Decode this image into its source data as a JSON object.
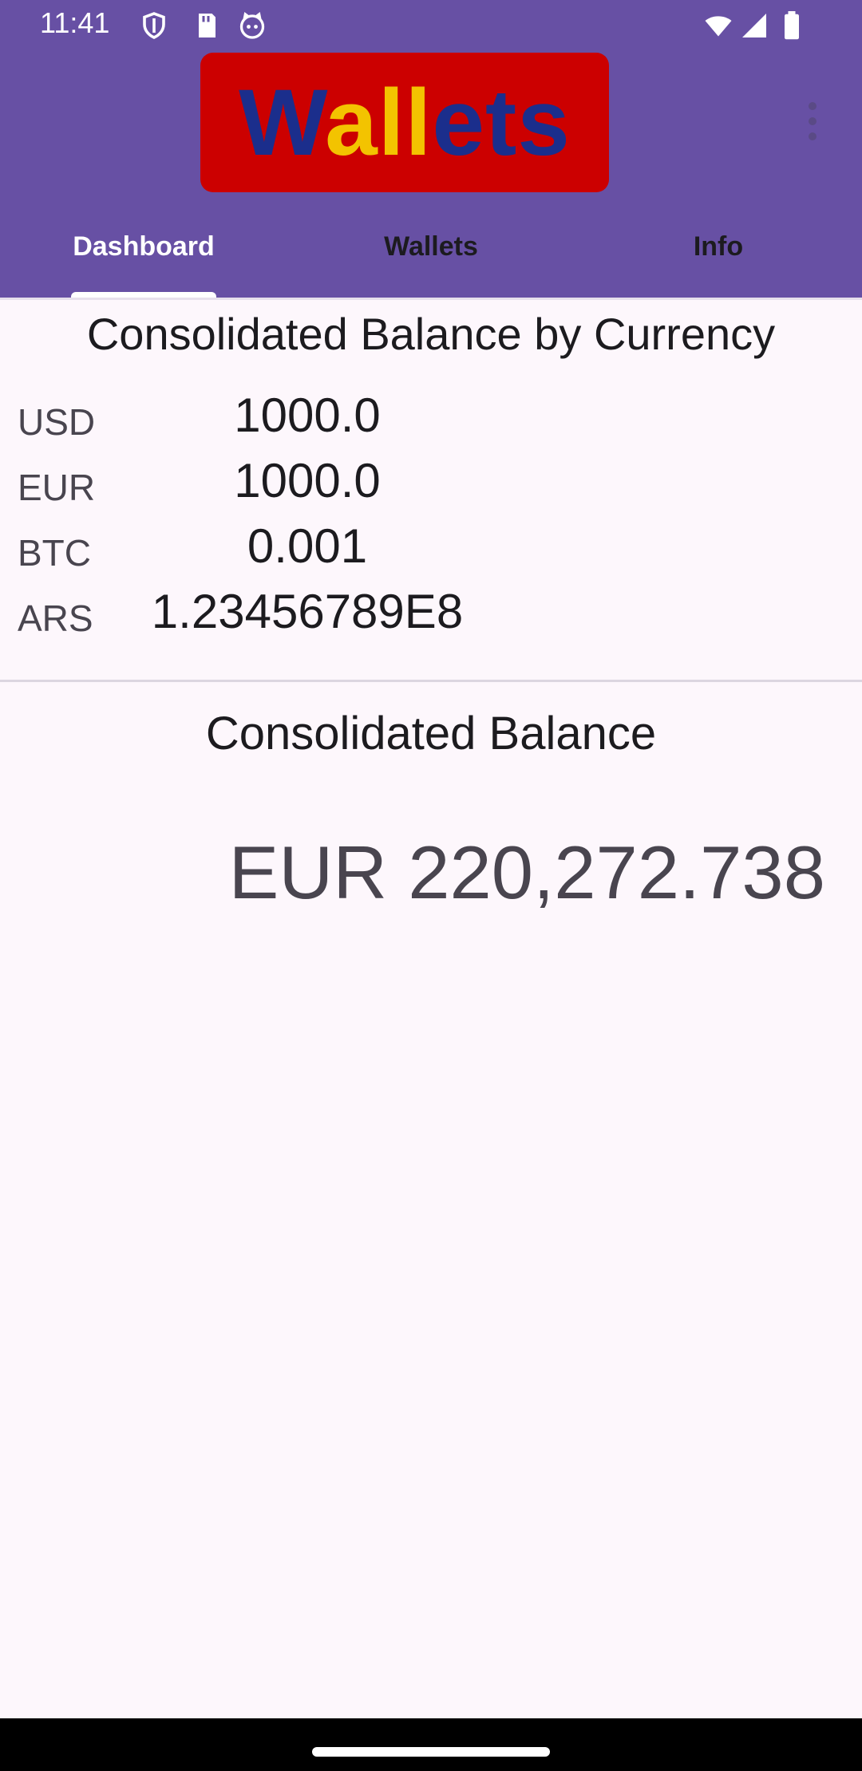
{
  "status_bar": {
    "time": "11:41",
    "icons": [
      "shield-icon",
      "sd-card-icon",
      "cat-face-icon"
    ],
    "right_icons": [
      "wifi-icon",
      "signal-icon",
      "battery-icon"
    ]
  },
  "app_bar": {
    "logo": {
      "text_parts": [
        "W",
        "a",
        "ll",
        "e",
        "ts"
      ],
      "colors": [
        "#1b2e8c",
        "#f3c300",
        "#f3c300",
        "#1b2e8c",
        "#1b2e8c"
      ],
      "background": "#cc0000"
    },
    "background": "#6750a4",
    "menu_icon": "more-vert-icon"
  },
  "tabs": [
    {
      "label": "Dashboard",
      "active": true
    },
    {
      "label": "Wallets",
      "active": false
    },
    {
      "label": "Info",
      "active": false
    }
  ],
  "balance_by_currency": {
    "title": "Consolidated Balance by Currency",
    "rows": [
      {
        "currency": "USD",
        "value": "1000.0"
      },
      {
        "currency": "EUR",
        "value": "1000.0"
      },
      {
        "currency": "BTC",
        "value": "0.001"
      },
      {
        "currency": "ARS",
        "value": "1.23456789E8"
      }
    ]
  },
  "consolidated": {
    "title": "Consolidated Balance",
    "total": "EUR 220,272.738"
  }
}
